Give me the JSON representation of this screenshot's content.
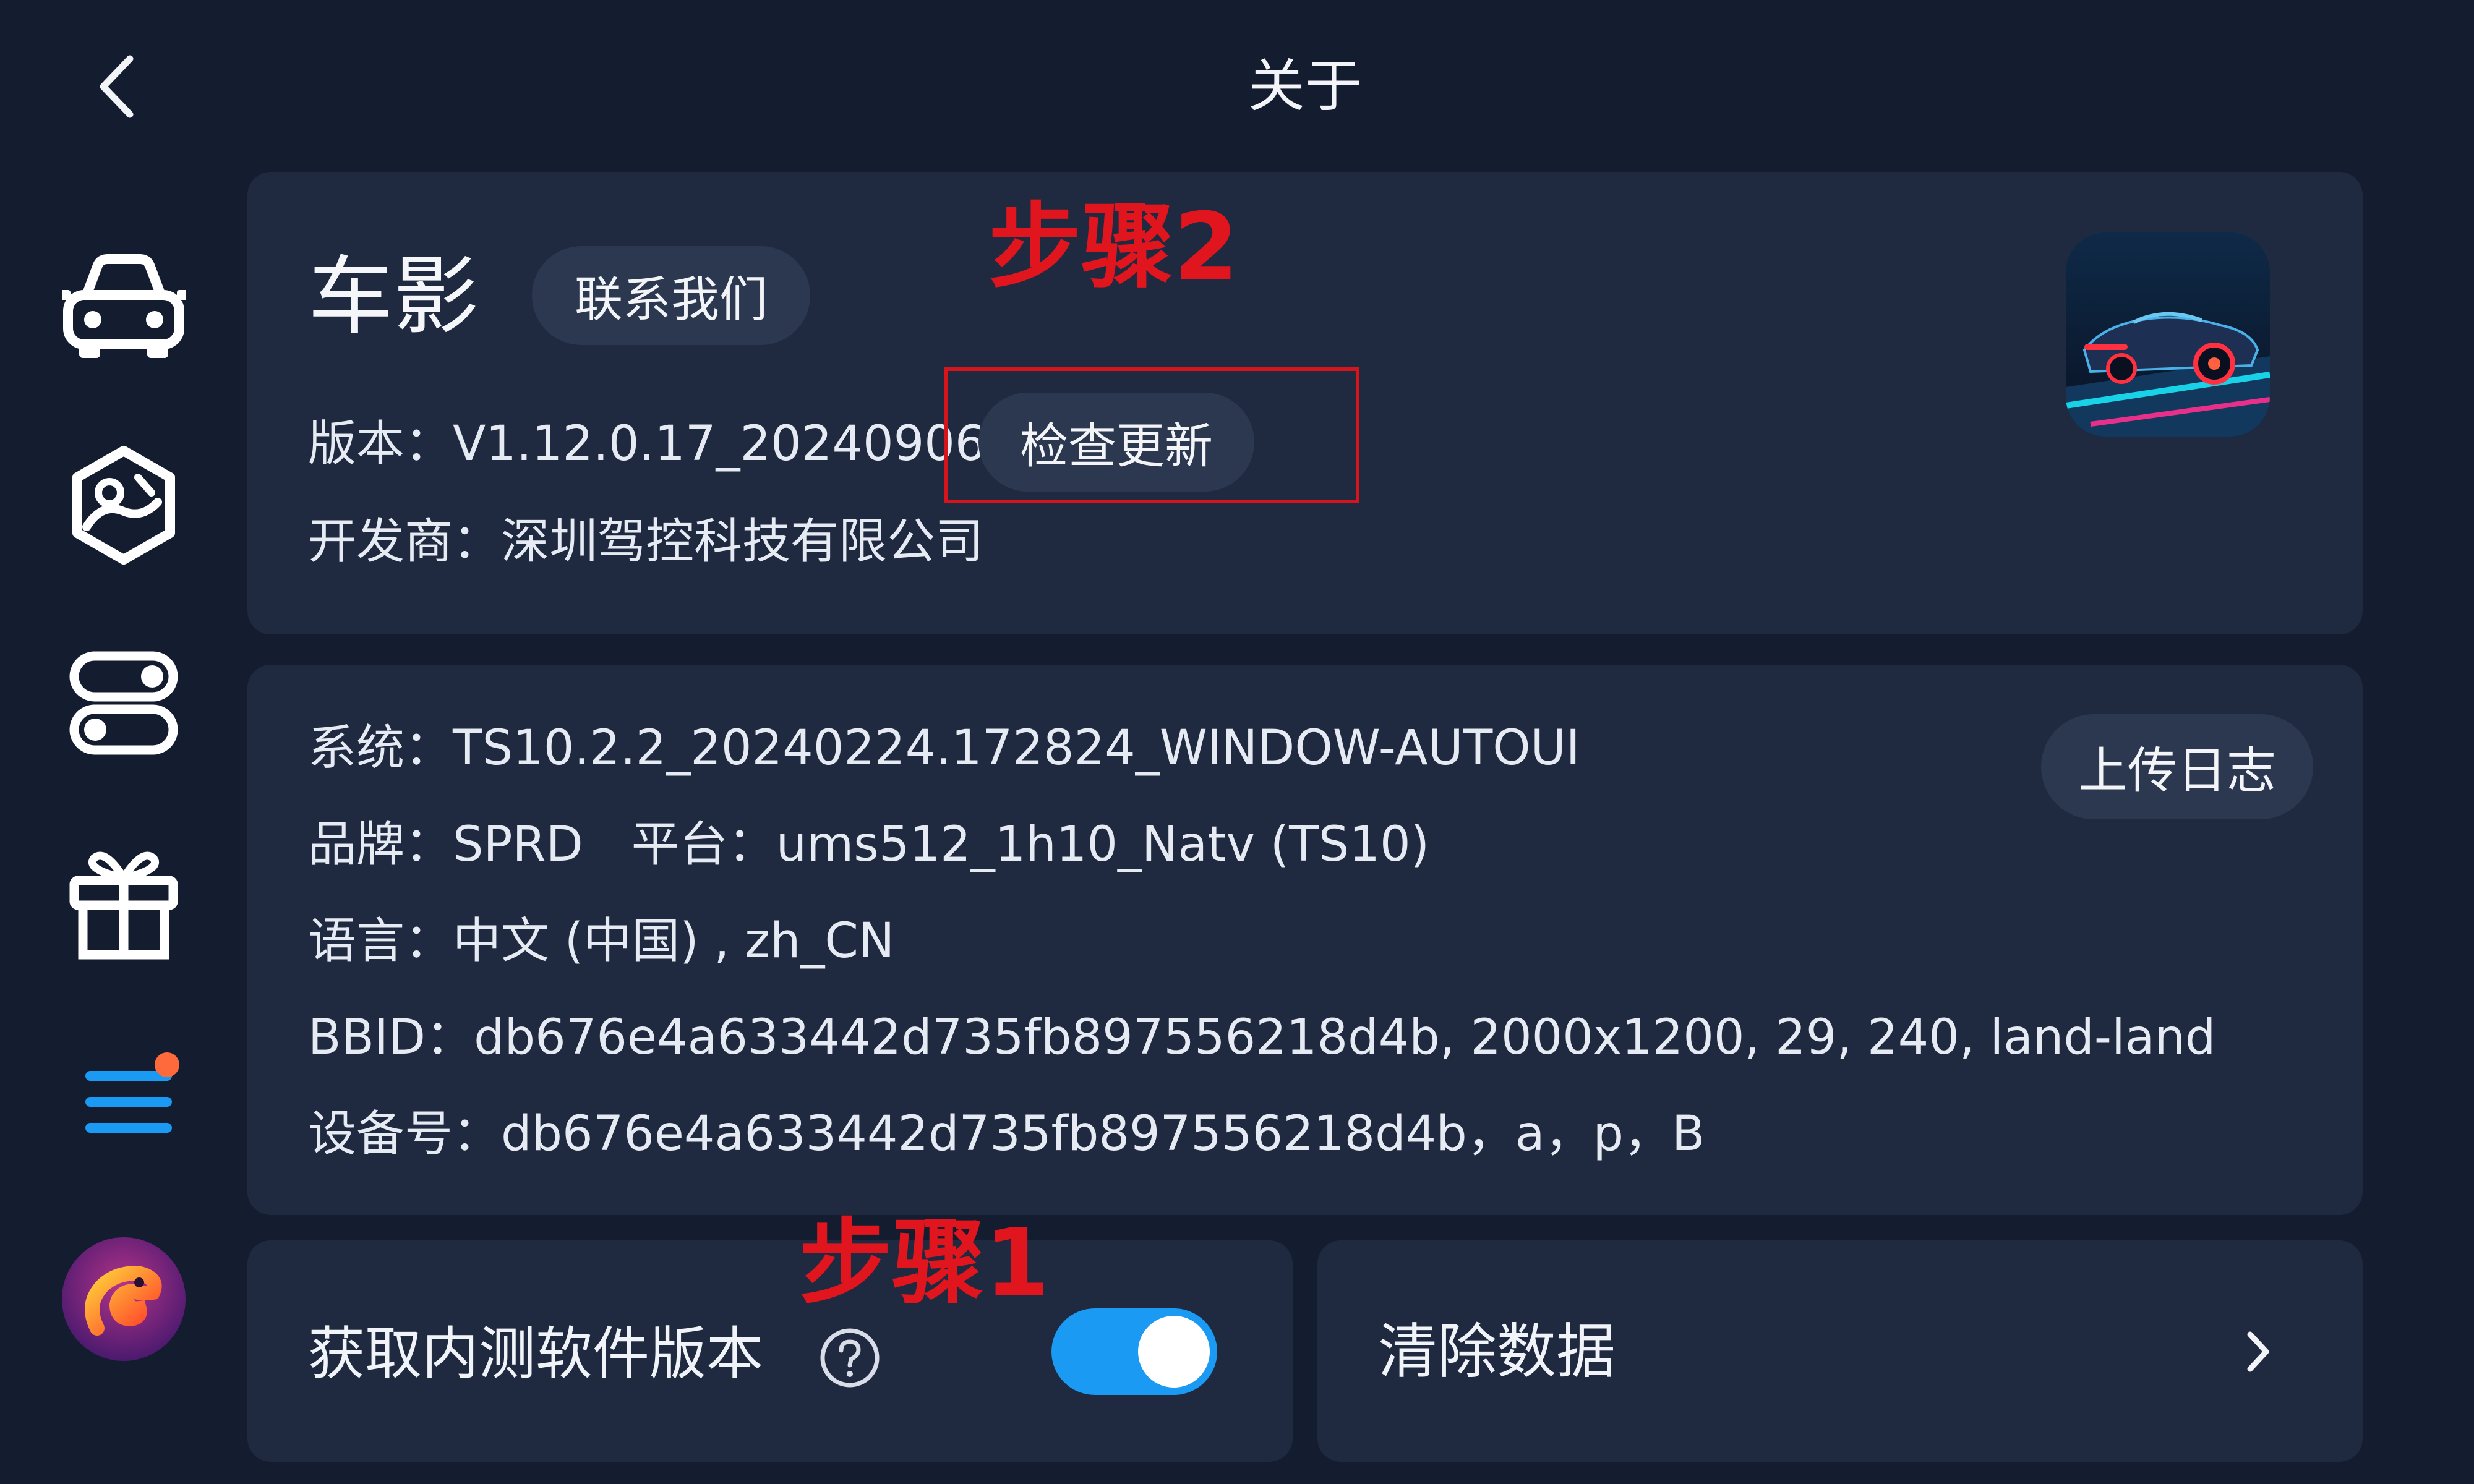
{
  "header": {
    "title": "关于"
  },
  "app": {
    "name": "车影",
    "contact_label": "联系我们",
    "version_text": "版本：V1.12.0.17_20240906",
    "check_update_label": "检查更新",
    "developer_text": "开发商：深圳驾控科技有限公司"
  },
  "system": {
    "system_line": "系统：TS10.2.2_20240224.172824_WINDOW-AUTOUI",
    "brand_platform_line": "品牌：SPRD　平台：ums512_1h10_Natv (TS10)",
    "language_line": "语言：中文 (中国) , zh_CN",
    "bbid_line": "BBID：db676e4a633442d735fb897556218d4b, 2000x1200, 29, 240, land-land",
    "device_line": "设备号：db676e4a633442d735fb897556218d4b，a，p，B",
    "upload_log_label": "上传日志"
  },
  "beta": {
    "label": "获取内测软件版本",
    "help_icon": "question-circle-icon",
    "toggle_on": true
  },
  "clear": {
    "label": "清除数据"
  },
  "annotations": {
    "step2": "步骤2",
    "step1": "步骤1"
  },
  "sidebar": {
    "icons": [
      "car-icon",
      "steering-map-icon",
      "toggles-icon",
      "gift-icon",
      "menu-icon",
      "chameleon-avatar-icon"
    ],
    "menu_badge": true
  },
  "colors": {
    "background": "#141d30",
    "card": "#1f2a40",
    "pill": "#2c3850",
    "accent": "#1a9af2",
    "badge": "#ff6a3d",
    "annotation": "#e0151d"
  }
}
